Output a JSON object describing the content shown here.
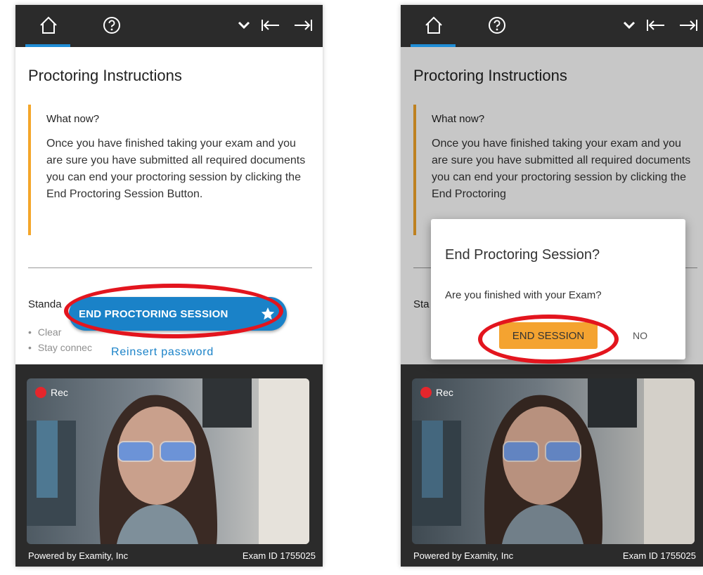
{
  "left_panel": {
    "heading": "Proctoring Instructions",
    "callout_heading": "What now?",
    "callout_body": "Once you have finished taking your exam and you are sure you have submitted all required documents you can end your proctoring session by clicking the End Proctoring Session Button.",
    "standards_heading": "Standa",
    "bullets": [
      "Clear",
      "Stay connec"
    ],
    "end_button_label": "END PROCTORING SESSION",
    "reinsert_link": "Reinsert password",
    "rec_label": "Rec",
    "footer_left": "Powered by Examity, Inc",
    "footer_right": "Exam ID 1755025"
  },
  "right_panel": {
    "heading": "Proctoring Instructions",
    "callout_heading": "What now?",
    "callout_body": "Once you have finished taking your exam and you are sure you have submitted all required documents you can end your proctoring session by clicking the End Proctoring",
    "standards_heading": "Sta",
    "dialog_title": "End Proctoring Session?",
    "dialog_text": "Are you finished with your Exam?",
    "end_session_label": "END SESSION",
    "no_label": "NO",
    "rec_label": "Rec",
    "footer_left": "Powered by Examity, Inc",
    "footer_right": "Exam ID 1755025"
  },
  "icons": [
    "home-icon",
    "help-icon",
    "chevron-down-icon",
    "collapse-left-icon",
    "expand-right-icon",
    "star-icon"
  ],
  "colors": {
    "topbar": "#2b2b2b",
    "accent_blue": "#1a82c8",
    "callout_border": "#f4a62a",
    "end_session_button": "#f4a330",
    "highlight_ring": "#e3151e",
    "rec_dot": "#e5262c"
  }
}
